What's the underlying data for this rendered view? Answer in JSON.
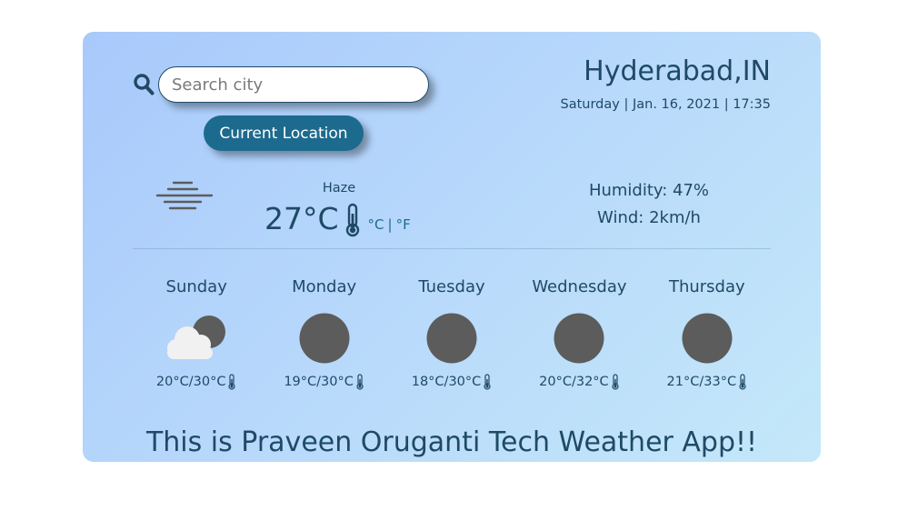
{
  "search": {
    "placeholder": "Search city",
    "icon": "search-icon",
    "current_location_label": "Current Location"
  },
  "location": {
    "city": "Hyderabad,IN",
    "datetime": "Saturday | Jan. 16, 2021 | 17:35"
  },
  "current": {
    "icon": "haze-icon",
    "condition": "Haze",
    "temperature": "27°C",
    "unit_c": "°C",
    "unit_separator": "|",
    "unit_f": "°F",
    "humidity": "Humidity: 47%",
    "wind": "Wind: 2km/h"
  },
  "forecast": [
    {
      "day": "Sunday",
      "icon": "partly-cloudy-icon",
      "temps": "20°C/30°C"
    },
    {
      "day": "Monday",
      "icon": "clear-icon",
      "temps": "19°C/30°C"
    },
    {
      "day": "Tuesday",
      "icon": "clear-icon",
      "temps": "18°C/30°C"
    },
    {
      "day": "Wednesday",
      "icon": "clear-icon",
      "temps": "20°C/32°C"
    },
    {
      "day": "Thursday",
      "icon": "clear-icon",
      "temps": "21°C/33°C"
    }
  ],
  "footer": {
    "tagline": "This is Praveen Oruganti Tech Weather App!!"
  },
  "colors": {
    "accent": "#1d6a8f",
    "text": "#1e4a66",
    "icon_dark": "#5c5c5c"
  }
}
